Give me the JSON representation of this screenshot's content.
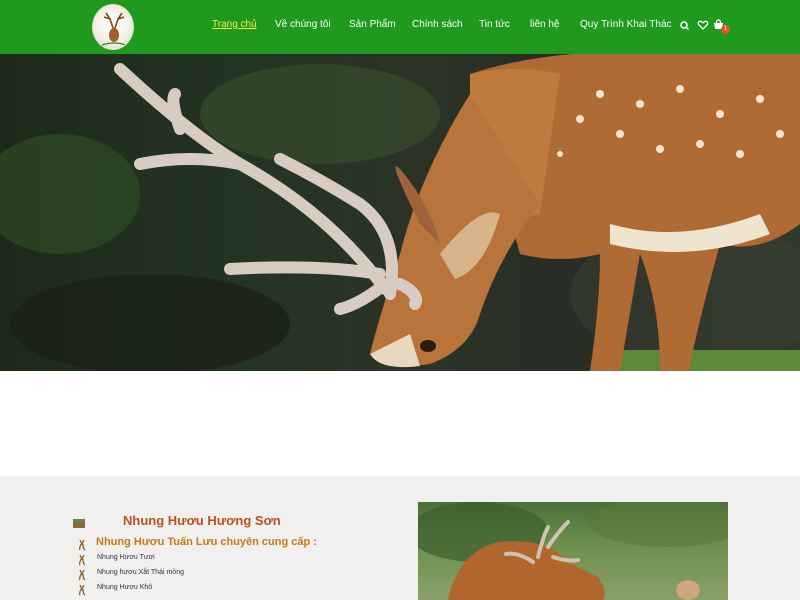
{
  "header": {
    "nav": [
      {
        "label": "Trang chủ",
        "active": true
      },
      {
        "label": "Về chúng tôi",
        "active": false
      },
      {
        "label": "Sản Phẩm",
        "active": false
      },
      {
        "label": "Chính sách",
        "active": false
      },
      {
        "label": "Tin tức",
        "active": false
      },
      {
        "label": "liên hệ",
        "active": false
      },
      {
        "label": "Quy Trình Khai Thác",
        "active": false
      }
    ],
    "icons": [
      "search-icon",
      "heart-icon",
      "cart-icon"
    ],
    "cart_count": "1"
  },
  "section": {
    "title": "Nhung Hươu Hương Sơn",
    "subtitle": "Nhung Hươu Tuấn Lưu chuyên cung cấp :",
    "items": [
      "Nhung Hươu Tươi",
      "Nhung hươu Xắt Thái mỏng",
      "Nhung Hươu Khô"
    ]
  },
  "colors": {
    "header_bg": "#1f9a1f",
    "active_nav": "#f5e94a",
    "section_title": "#b5521f",
    "subtitle": "#c77a12",
    "section_bg": "#f1f0ee"
  }
}
